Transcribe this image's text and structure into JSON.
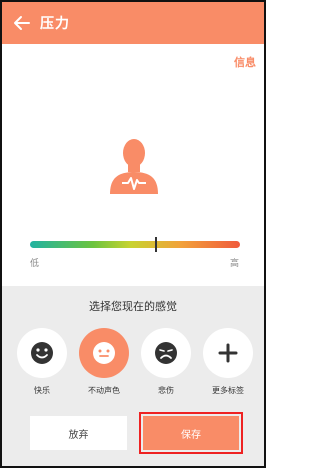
{
  "header": {
    "title": "压力",
    "back_icon": "arrow-left-icon"
  },
  "info_link": "信息",
  "stress": {
    "low_label": "低",
    "high_label": "高",
    "level": 0.6,
    "gradient_colors": [
      "#22b3a2",
      "#6cc43f",
      "#c8d330",
      "#f2a13a",
      "#f05a3c"
    ]
  },
  "prompt": "选择您现在的感觉",
  "moods": [
    {
      "label": "快乐",
      "icon": "happy-face-icon",
      "selected": false
    },
    {
      "label": "不动声色",
      "icon": "neutral-face-icon",
      "selected": true
    },
    {
      "label": "悲伤",
      "icon": "sad-face-icon",
      "selected": false
    },
    {
      "label": "更多标签",
      "icon": "plus-icon",
      "selected": false
    }
  ],
  "buttons": {
    "discard": "放弃",
    "save": "保存"
  },
  "colors": {
    "accent": "#f98c67",
    "panel": "#ececec",
    "highlight": "#e22222"
  }
}
